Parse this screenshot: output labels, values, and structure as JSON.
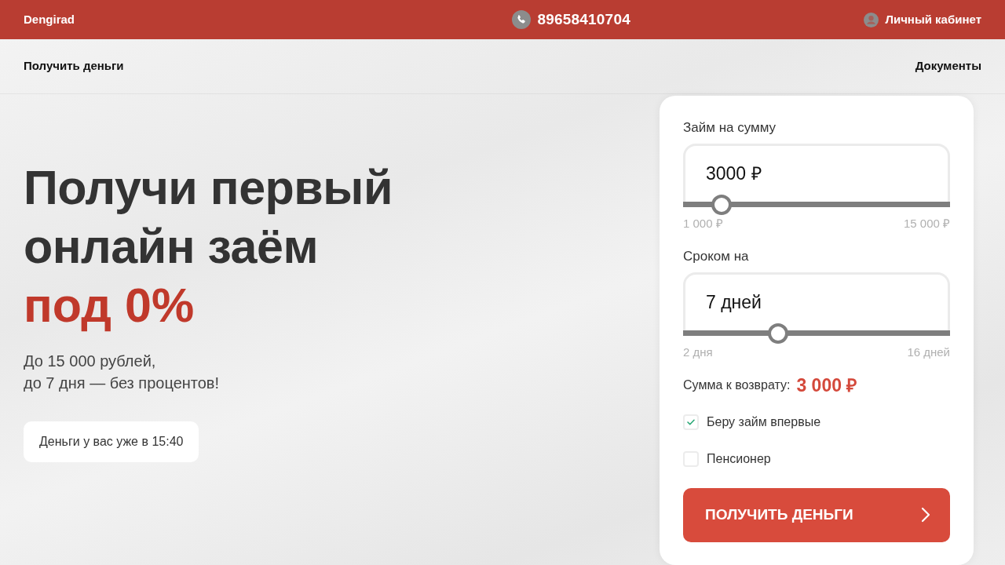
{
  "header": {
    "brand": "Dengirad",
    "phone": "89658410704",
    "account_link": "Личный кабинет"
  },
  "nav": [
    {
      "label": "Получить деньги"
    },
    {
      "label": "Документы"
    }
  ],
  "hero": {
    "title": "Получи первый\nонлайн заём",
    "title_accent": "под 0%",
    "subtitle": "До 15 000 рублей,\nдо 7 дня — без процентов!",
    "pill": "Деньги у вас уже в 15:40"
  },
  "calculator": {
    "sliders": [
      {
        "label": "Займ на сумму",
        "value": "3000 ₽",
        "level": 0.143,
        "min_label": "1 000 ₽",
        "max_label": "15 000 ₽"
      },
      {
        "label": "Сроком на",
        "value": "7 дней",
        "level": 0.357,
        "min_label": "2 дня",
        "max_label": "16 дней"
      }
    ],
    "total_label": "Сумма к возврату:",
    "total_value": "3 000 ₽",
    "checkboxes": [
      {
        "label": "Беру займ впервые",
        "checked": true
      },
      {
        "label": "Пенсионер",
        "checked": false
      }
    ],
    "submit": "ПОЛУЧИТЬ ДЕНЬГИ"
  }
}
